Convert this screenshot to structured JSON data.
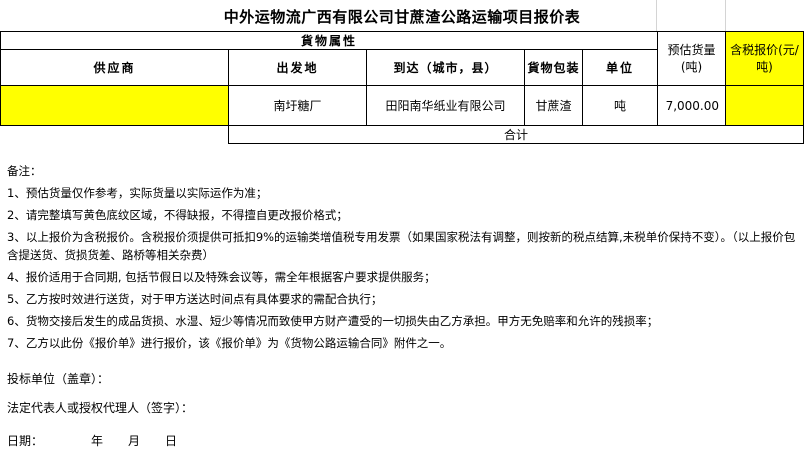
{
  "title": "中外运物流广西有限公司甘蔗渣公路运输项目报价表",
  "table": {
    "group_header": "貨物属性",
    "headers": {
      "supplier": "供应商",
      "origin": "出发地",
      "destination": "到达（城市，县）",
      "packaging": "貨物包装",
      "unit": "单位",
      "estimated_volume": "预估货量(吨)",
      "tax_price": "含税报价(元/吨)"
    },
    "row": {
      "supplier": "",
      "origin": "南圩糖厂",
      "destination": "田阳南华纸业有限公司",
      "packaging": "甘蔗渣",
      "unit": "吨",
      "estimated_volume": "7,000.00",
      "tax_price": ""
    },
    "total_label": "合计",
    "colors": {
      "highlight": "#ffff00"
    }
  },
  "notes": {
    "heading": "备注：",
    "items": [
      "1、预估货量仅作参考，实际货量以实际运作为准；",
      "2、请完整填写黄色底纹区域，不得缺报，不得擅自更改报价格式；",
      "3、以上报价为含税报价。含税报价须提供可抵扣9%的运输类增值税专用发票（如果国家税法有调整，则按新的税点结算,未税单价保持不变）。（以上报价包含提送货、货损货差、路桥等相关杂费）",
      "4、报价适用于合同期, 包括节假日以及特殊会议等，需全年根据客户要求提供服务；",
      "5、乙方按时效进行送货，对于甲方送达时间点有具体要求的需配合执行；",
      "6、货物交接后发生的成品货损、水湿、短少等情况而致使甲方财产遭受的一切损失由乙方承担。甲方无免赔率和允许的残损率；",
      "7、乙方以此份《报价单》进行报价，该《报价单》为《货物公路运输合同》附件之一。"
    ]
  },
  "signature": {
    "bidder": "投标单位（盖章）：",
    "representative": "法定代表人或授权代理人（签字）：",
    "date_label": "日期：",
    "year": "年",
    "month": "月",
    "day": "日"
  }
}
